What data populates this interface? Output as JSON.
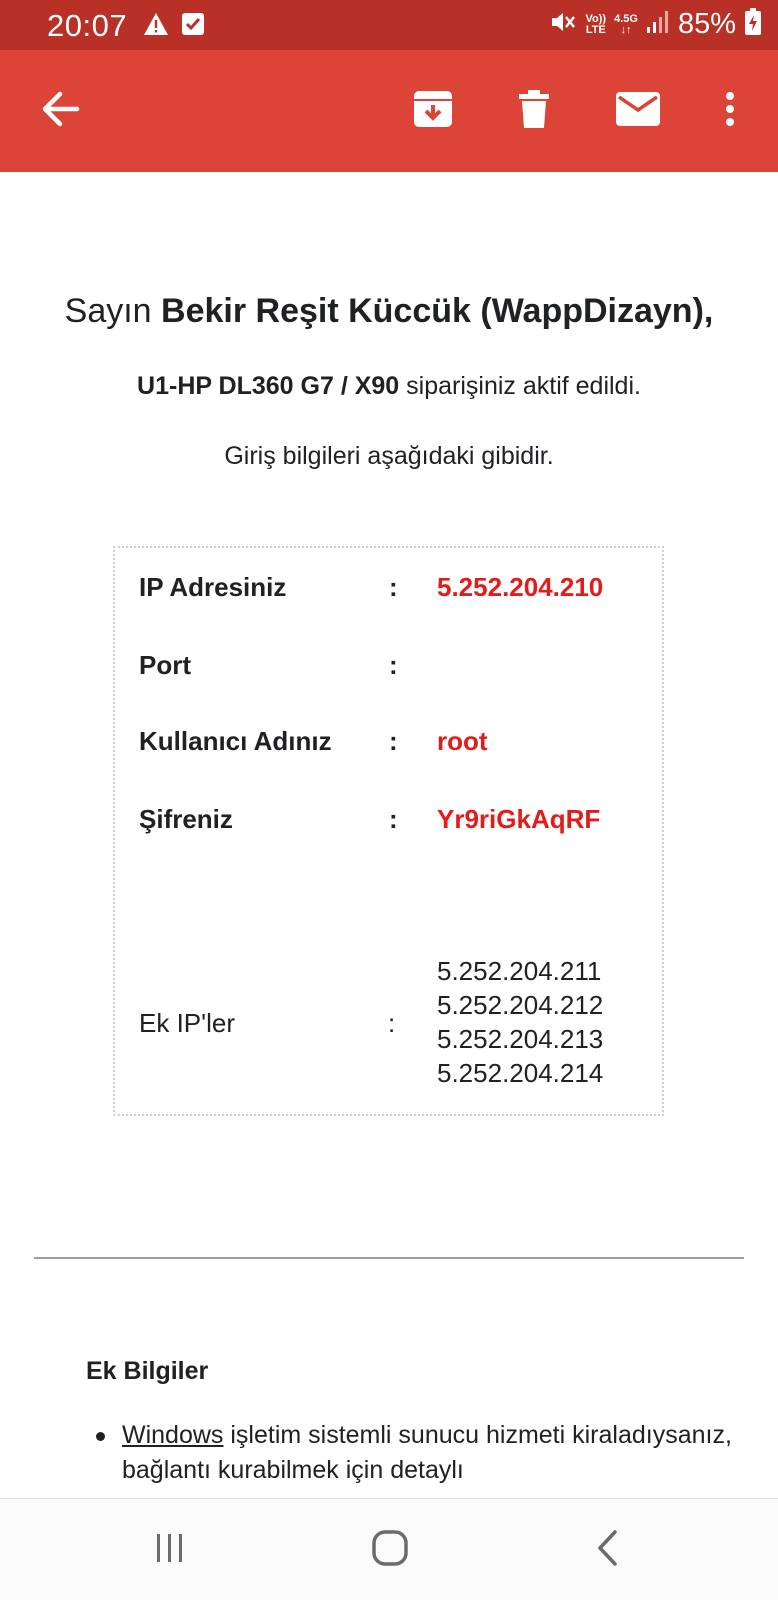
{
  "status_bar": {
    "time": "20:07",
    "network_top": "4.5G",
    "volte_top": "Vo))",
    "volte_bottom": "LTE",
    "battery": "85%"
  },
  "app_bar": {
    "icons": [
      "back-arrow-icon",
      "archive-icon",
      "delete-icon",
      "mail-icon",
      "more-vertical-icon"
    ]
  },
  "email": {
    "greeting_prefix": "Sayın ",
    "greeting_name": "Bekir Reşit Küccük (WappDizayn),",
    "order_product": "U1-HP DL360 G7 / X90",
    "order_suffix": " siparişiniz aktif edildi.",
    "login_info": "Giriş bilgileri aşağıdaki gibidir.",
    "credentials": {
      "colon": ":",
      "ip_label": "IP Adresiniz",
      "ip_value": "5.252.204.210",
      "port_label": "Port",
      "port_value": "",
      "user_label": "Kullanıcı Adınız",
      "user_value": "root",
      "pass_label": "Şifreniz",
      "pass_value": "Yr9riGkAqRF",
      "extra_label": "Ek IP'ler",
      "extra_ips": [
        "5.252.204.211",
        "5.252.204.212",
        "5.252.204.213",
        "5.252.204.214"
      ]
    },
    "extra_section_title": "Ek Bilgiler",
    "bullet_link": "Windows",
    "bullet_text": " işletim sistemli sunucu hizmeti kiraladıysanız, bağlantı kurabilmek için detaylı"
  },
  "colors": {
    "status_bar": "#b93126",
    "app_bar": "#db4437",
    "value_red": "#e41b1b"
  }
}
